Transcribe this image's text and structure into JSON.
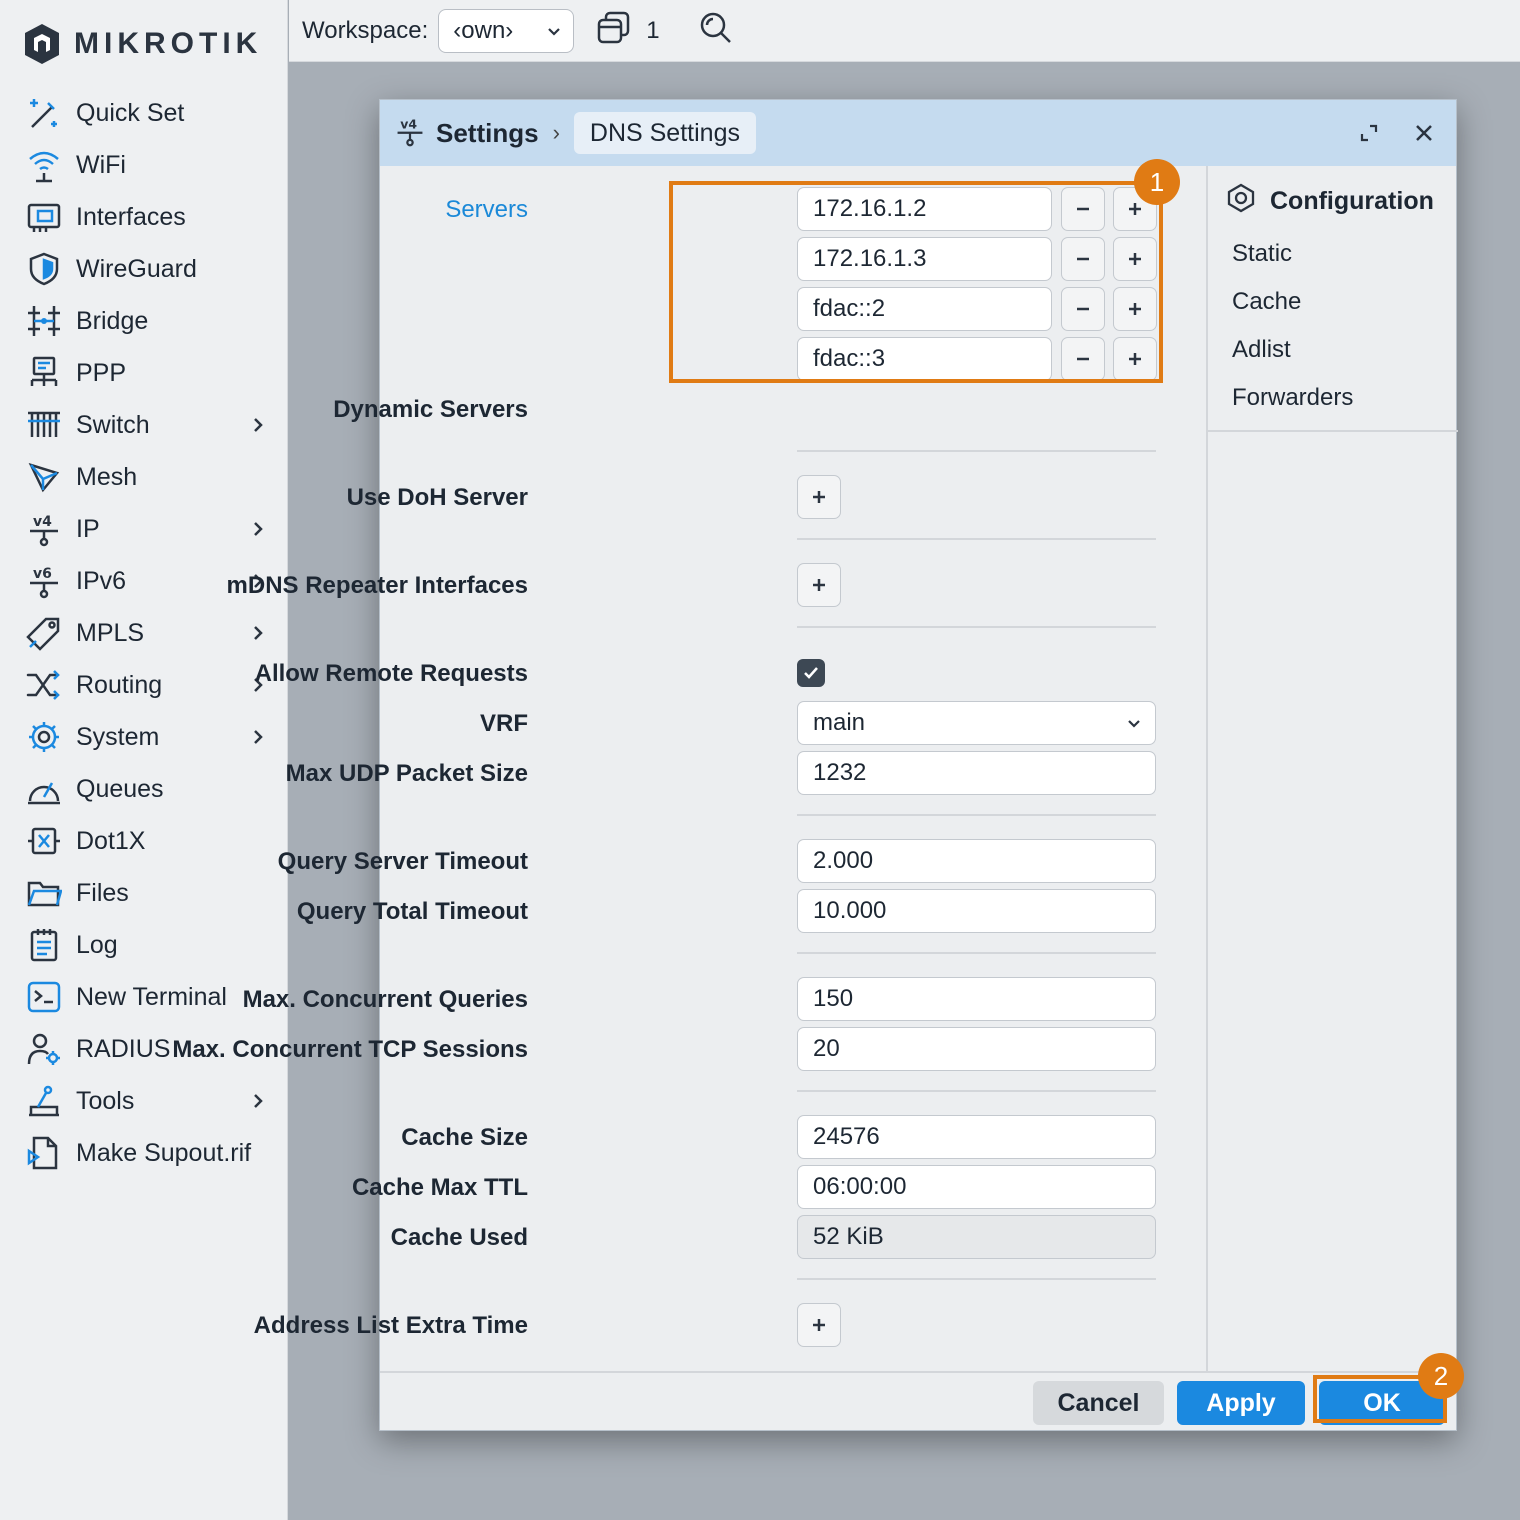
{
  "brand": {
    "logo_text": "MIKROTIK"
  },
  "nav": {
    "items": [
      {
        "label": "Quick Set"
      },
      {
        "label": "WiFi"
      },
      {
        "label": "Interfaces"
      },
      {
        "label": "WireGuard"
      },
      {
        "label": "Bridge"
      },
      {
        "label": "PPP"
      },
      {
        "label": "Switch"
      },
      {
        "label": "Mesh"
      },
      {
        "label": "IP"
      },
      {
        "label": "IPv6"
      },
      {
        "label": "MPLS"
      },
      {
        "label": "Routing"
      },
      {
        "label": "System"
      },
      {
        "label": "Queues"
      },
      {
        "label": "Dot1X"
      },
      {
        "label": "Files"
      },
      {
        "label": "Log"
      },
      {
        "label": "New Terminal"
      },
      {
        "label": "RADIUS"
      },
      {
        "label": "Tools"
      },
      {
        "label": "Make Supout.rif"
      }
    ]
  },
  "topbar": {
    "workspace_label": "Workspace:",
    "workspace_value": "‹own›",
    "window_count": "1"
  },
  "dialog": {
    "breadcrumb_root": "Settings",
    "breadcrumb_sep": "›",
    "breadcrumb_tab": "DNS Settings"
  },
  "form": {
    "servers_label": "Servers",
    "servers": [
      "172.16.1.2",
      "172.16.1.3",
      "fdac::2",
      "fdac::3"
    ],
    "dynamic_servers_label": "Dynamic Servers",
    "use_doh_label": "Use DoH Server",
    "mdns_label": "mDNS Repeater Interfaces",
    "allow_remote_label": "Allow Remote Requests",
    "vrf_label": "VRF",
    "vrf_value": "main",
    "max_udp_label": "Max UDP Packet Size",
    "max_udp_value": "1232",
    "qs_timeout_label": "Query Server Timeout",
    "qs_timeout_value": "2.000",
    "qt_timeout_label": "Query Total Timeout",
    "qt_timeout_value": "10.000",
    "max_queries_label": "Max. Concurrent Queries",
    "max_queries_value": "150",
    "max_tcp_label": "Max. Concurrent TCP Sessions",
    "max_tcp_value": "20",
    "cache_size_label": "Cache Size",
    "cache_size_value": "24576",
    "cache_ttl_label": "Cache Max TTL",
    "cache_ttl_value": "06:00:00",
    "cache_used_label": "Cache Used",
    "cache_used_value": "52 KiB",
    "addr_extra_label": "Address List Extra Time"
  },
  "side": {
    "title": "Configuration",
    "items": [
      "Static",
      "Cache",
      "Adlist",
      "Forwarders"
    ]
  },
  "footer": {
    "cancel": "Cancel",
    "apply": "Apply",
    "ok": "OK"
  },
  "callouts": {
    "one": "1",
    "two": "2"
  },
  "colors": {
    "accent": "#1b89e0",
    "highlight": "#e07b14",
    "header": "#c5dbef"
  }
}
